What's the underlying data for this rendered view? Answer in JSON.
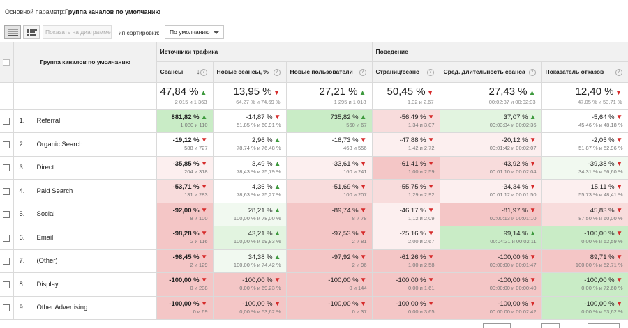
{
  "topbar": {
    "primary_dimension_label": "Основной параметр:",
    "primary_dimension_value": "Группа каналов по умолчанию"
  },
  "toolbar": {
    "show_on_chart": "Показать на диаграмме",
    "sort_type_label": "Тип сортировки:",
    "sort_type_value": "По умолчанию"
  },
  "header": {
    "dimension": "Группа каналов по умолчанию",
    "groups": {
      "traffic": "Источники трафика",
      "behavior": "Поведение"
    },
    "columns": [
      "Сеансы",
      "Новые сеансы, %",
      "Новые пользователи",
      "Страниц/сеанс",
      "Сред. длительность сеанса",
      "Показатель отказов"
    ]
  },
  "totals": [
    {
      "value": "47,84 %",
      "dir": "up",
      "sub": "2 015 и 1 363"
    },
    {
      "value": "13,95 %",
      "dir": "down",
      "sub": "64,27 % и 74,69 %"
    },
    {
      "value": "27,21 %",
      "dir": "up",
      "sub": "1 295 и 1 018"
    },
    {
      "value": "50,45 %",
      "dir": "down",
      "sub": "1,32 и 2,67"
    },
    {
      "value": "27,43 %",
      "dir": "up",
      "sub": "00:02:37 и 00:02:03"
    },
    {
      "value": "12,40 %",
      "dir": "down",
      "sub": "47,05 % и 53,71 %"
    }
  ],
  "rows": [
    {
      "num": "1.",
      "name": "Referral",
      "cells": [
        {
          "value": "881,82 %",
          "dir": "up",
          "sub": "1 080 и 110",
          "tone": "g1",
          "bold": true
        },
        {
          "value": "-14,87 %",
          "dir": "down",
          "sub": "51,85 % и 60,91 %",
          "tone": "w"
        },
        {
          "value": "735,82 %",
          "dir": "up",
          "sub": "560 и 67",
          "tone": "g1"
        },
        {
          "value": "-56,49 %",
          "dir": "down",
          "sub": "1,34 и 3,07",
          "tone": "r2"
        },
        {
          "value": "37,07 %",
          "dir": "up",
          "sub": "00:03:34 и 00:02:36",
          "tone": "g2"
        },
        {
          "value": "-5,64 %",
          "dir": "down",
          "sub": "45,46 % и 48,18 %",
          "tone": "w"
        }
      ]
    },
    {
      "num": "2.",
      "name": "Organic Search",
      "cells": [
        {
          "value": "-19,12 %",
          "dir": "down",
          "sub": "588 и 727",
          "tone": "w",
          "bold": true
        },
        {
          "value": "2,96 %",
          "dir": "up",
          "sub": "78,74 % и 76,48 %",
          "tone": "w"
        },
        {
          "value": "-16,73 %",
          "dir": "down",
          "sub": "463 и 556",
          "tone": "w"
        },
        {
          "value": "-47,88 %",
          "dir": "down",
          "sub": "1,42 и 2,72",
          "tone": "r3"
        },
        {
          "value": "-20,12 %",
          "dir": "down",
          "sub": "00:01:42 и 00:02:07",
          "tone": "r3"
        },
        {
          "value": "-2,05 %",
          "dir": "down",
          "sub": "51,87 % и 52,96 %",
          "tone": "w"
        }
      ]
    },
    {
      "num": "3.",
      "name": "Direct",
      "cells": [
        {
          "value": "-35,85 %",
          "dir": "down",
          "sub": "204 и 318",
          "tone": "r3",
          "bold": true
        },
        {
          "value": "3,49 %",
          "dir": "up",
          "sub": "78,43 % и 75,79 %",
          "tone": "w"
        },
        {
          "value": "-33,61 %",
          "dir": "down",
          "sub": "160 и 241",
          "tone": "r3"
        },
        {
          "value": "-61,41 %",
          "dir": "down",
          "sub": "1,00 и 2,59",
          "tone": "r1"
        },
        {
          "value": "-43,92 %",
          "dir": "down",
          "sub": "00:01:10 и 00:02:04",
          "tone": "r2"
        },
        {
          "value": "-39,38 %",
          "dir": "down",
          "sub": "34,31 % и 56,60 %",
          "tone": "g3"
        }
      ]
    },
    {
      "num": "4.",
      "name": "Paid Search",
      "cells": [
        {
          "value": "-53,71 %",
          "dir": "down",
          "sub": "131 и 283",
          "tone": "r2",
          "bold": true
        },
        {
          "value": "4,36 %",
          "dir": "up",
          "sub": "78,63 % и 75,27 %",
          "tone": "w"
        },
        {
          "value": "-51,69 %",
          "dir": "down",
          "sub": "100 и 207",
          "tone": "r2"
        },
        {
          "value": "-55,75 %",
          "dir": "down",
          "sub": "1,29 и 2,92",
          "tone": "r2"
        },
        {
          "value": "-34,34 %",
          "dir": "down",
          "sub": "00:01:12 и 00:01:50",
          "tone": "r3"
        },
        {
          "value": "15,11 %",
          "dir": "down",
          "sub": "55,73 % и 48,41 %",
          "tone": "r3"
        }
      ]
    },
    {
      "num": "5.",
      "name": "Social",
      "cells": [
        {
          "value": "-92,00 %",
          "dir": "down",
          "sub": "8 и 100",
          "tone": "r1",
          "bold": true
        },
        {
          "value": "28,21 %",
          "dir": "up",
          "sub": "100,00 % и 78,00 %",
          "tone": "g3"
        },
        {
          "value": "-89,74 %",
          "dir": "down",
          "sub": "8 и 78",
          "tone": "r1"
        },
        {
          "value": "-46,17 %",
          "dir": "down",
          "sub": "1,12 и 2,09",
          "tone": "r3"
        },
        {
          "value": "-81,97 %",
          "dir": "down",
          "sub": "00:00:13 и 00:01:10",
          "tone": "r1"
        },
        {
          "value": "45,83 %",
          "dir": "down",
          "sub": "87,50 % и 60,00 %",
          "tone": "r2"
        }
      ]
    },
    {
      "num": "6.",
      "name": "Email",
      "cells": [
        {
          "value": "-98,28 %",
          "dir": "down",
          "sub": "2 и 116",
          "tone": "r1",
          "bold": true
        },
        {
          "value": "43,21 %",
          "dir": "up",
          "sub": "100,00 % и 69,83 %",
          "tone": "g2"
        },
        {
          "value": "-97,53 %",
          "dir": "down",
          "sub": "2 и 81",
          "tone": "r1"
        },
        {
          "value": "-25,16 %",
          "dir": "down",
          "sub": "2,00 и 2,67",
          "tone": "r3"
        },
        {
          "value": "99,14 %",
          "dir": "up",
          "sub": "00:04:21 и 00:02:11",
          "tone": "g1"
        },
        {
          "value": "-100,00 %",
          "dir": "down",
          "sub": "0,00 % и 52,59 %",
          "tone": "g1"
        }
      ]
    },
    {
      "num": "7.",
      "name": "(Other)",
      "cells": [
        {
          "value": "-98,45 %",
          "dir": "down",
          "sub": "2 и 129",
          "tone": "r1",
          "bold": true
        },
        {
          "value": "34,38 %",
          "dir": "up",
          "sub": "100,00 % и 74,42 %",
          "tone": "g3"
        },
        {
          "value": "-97,92 %",
          "dir": "down",
          "sub": "2 и 96",
          "tone": "r1"
        },
        {
          "value": "-61,26 %",
          "dir": "down",
          "sub": "1,00 и 2,58",
          "tone": "r1"
        },
        {
          "value": "-100,00 %",
          "dir": "down",
          "sub": "00:00:00 и 00:01:47",
          "tone": "r1"
        },
        {
          "value": "89,71 %",
          "dir": "down",
          "sub": "100,00 % и 52,71 %",
          "tone": "r1"
        }
      ]
    },
    {
      "num": "8.",
      "name": "Display",
      "cells": [
        {
          "value": "-100,00 %",
          "dir": "down",
          "sub": "0 и 208",
          "tone": "r1",
          "bold": true
        },
        {
          "value": "-100,00 %",
          "dir": "down",
          "sub": "0,00 % и 69,23 %",
          "tone": "r1"
        },
        {
          "value": "-100,00 %",
          "dir": "down",
          "sub": "0 и 144",
          "tone": "r1"
        },
        {
          "value": "-100,00 %",
          "dir": "down",
          "sub": "0,00 и 1,61",
          "tone": "r1"
        },
        {
          "value": "-100,00 %",
          "dir": "down",
          "sub": "00:00:00 и 00:00:40",
          "tone": "r1"
        },
        {
          "value": "-100,00 %",
          "dir": "down",
          "sub": "0,00 % и 72,60 %",
          "tone": "g1"
        }
      ]
    },
    {
      "num": "9.",
      "name": "Other Advertising",
      "cells": [
        {
          "value": "-100,00 %",
          "dir": "down",
          "sub": "0 и 69",
          "tone": "r1",
          "bold": true
        },
        {
          "value": "-100,00 %",
          "dir": "down",
          "sub": "0,00 % и 53,62 %",
          "tone": "r1"
        },
        {
          "value": "-100,00 %",
          "dir": "down",
          "sub": "0 и 37",
          "tone": "r1"
        },
        {
          "value": "-100,00 %",
          "dir": "down",
          "sub": "0,00 и 3,65",
          "tone": "r1"
        },
        {
          "value": "-100,00 %",
          "dir": "down",
          "sub": "00:00:00 и 00:02:42",
          "tone": "r1"
        },
        {
          "value": "-100,00 %",
          "dir": "down",
          "sub": "0,00 % и 53,62 %",
          "tone": "g1"
        }
      ]
    }
  ],
  "colors": {
    "up_arrow": "#3e9a3e",
    "down_arrow": "#d62c2c",
    "strong_green": "#c9ecc6",
    "strong_red": "#f4c6c6"
  },
  "icons": {
    "table_view": "list-view-icon",
    "comparison_view": "comparison-view-icon",
    "help": "help-icon",
    "sort": "sort-arrow-icon",
    "up": "arrow-up-icon",
    "down": "arrow-down-icon"
  }
}
